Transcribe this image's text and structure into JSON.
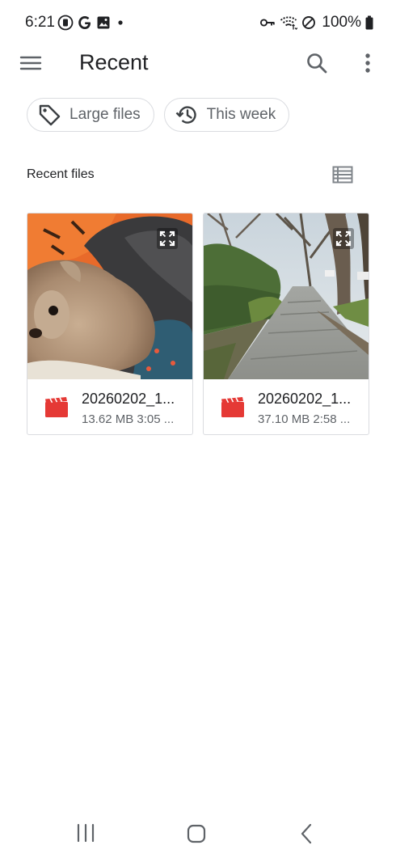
{
  "status_bar": {
    "time": "6:21",
    "battery_percent": "100%",
    "left_icons": [
      "dnd-icon",
      "google-icon",
      "gallery-icon",
      "dot-icon"
    ],
    "right_icons": [
      "vpn-key-icon",
      "wifi-icon",
      "blocked-icon",
      "battery-icon"
    ]
  },
  "app_bar": {
    "title": "Recent",
    "icons": [
      "menu-icon",
      "search-icon",
      "more-vert-icon"
    ]
  },
  "chips": [
    {
      "label": "Large files",
      "icon": "tag-icon"
    },
    {
      "label": "This week",
      "icon": "history-icon"
    }
  ],
  "section": {
    "title": "Recent files",
    "view_toggle_icon": "list-view-icon"
  },
  "files": [
    {
      "name": "20260202_1...",
      "meta": "13.62 MB 3:05 ...",
      "type_icon": "video-icon",
      "thumbnail": "dog-photo"
    },
    {
      "name": "20260202_1...",
      "meta": "37.10 MB 2:58 ...",
      "type_icon": "video-icon",
      "thumbnail": "sidewalk-photo"
    }
  ],
  "colors": {
    "video_icon_red": "#e53935",
    "text_primary": "#202124",
    "text_secondary": "#5f6368",
    "chip_border": "#dadce0"
  },
  "nav_bar": {
    "icons": [
      "recents-icon",
      "home-icon",
      "back-icon"
    ]
  }
}
